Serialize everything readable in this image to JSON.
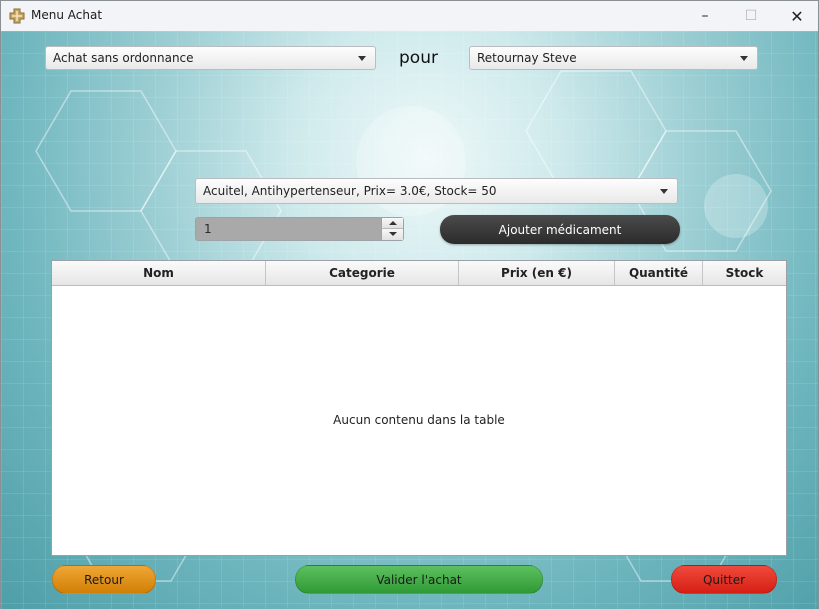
{
  "window": {
    "title": "Menu Achat",
    "controls": {
      "minimize": "–",
      "maximize": "☐",
      "close": "✕"
    }
  },
  "header": {
    "purchase_type": "Achat sans ordonnance",
    "pour_label": "pour",
    "client": "Retournay Steve"
  },
  "medication_select": {
    "selected": "Acuitel, Antihypertenseur, Prix= 3.0€, Stock= 50"
  },
  "quantity": {
    "value": "1"
  },
  "add_button": {
    "label": "Ajouter médicament"
  },
  "table": {
    "columns": [
      "Nom",
      "Categorie",
      "Prix (en €)",
      "Quantité",
      "Stock"
    ],
    "rows": [],
    "empty_text": "Aucun contenu dans la table"
  },
  "footer": {
    "back_label": "Retour",
    "validate_label": "Valider l'achat",
    "quit_label": "Quitter"
  },
  "colors": {
    "back": "#e58f1c",
    "validate": "#43ad47",
    "quit": "#e4342a",
    "add_button": "#3a3a3a"
  }
}
